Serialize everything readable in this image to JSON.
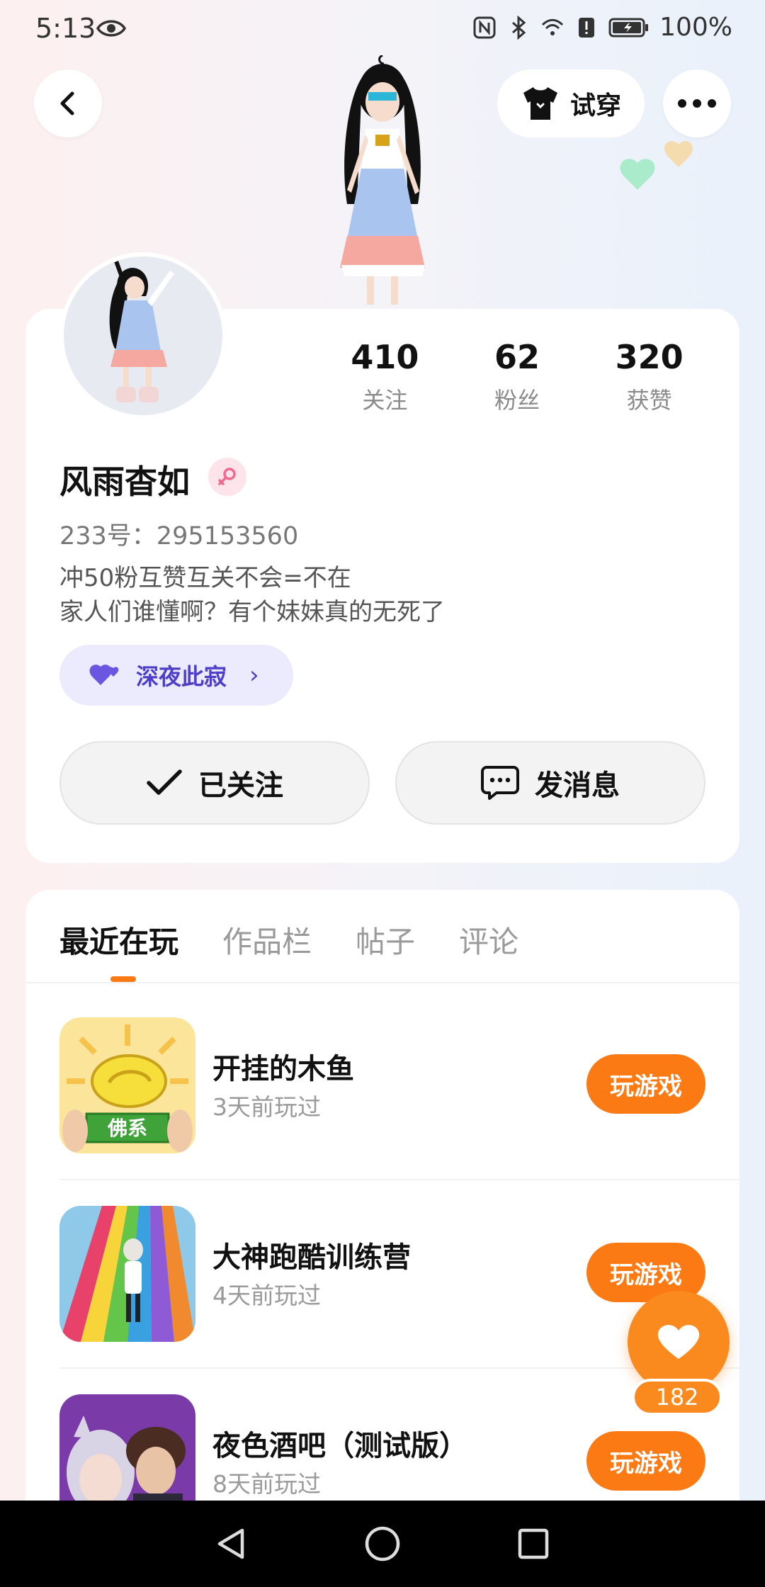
{
  "status_bar": {
    "time": "5:13",
    "battery": "100%"
  },
  "top_nav": {
    "try_on_label": "试穿"
  },
  "profile": {
    "stats": [
      {
        "value": "410",
        "label": "关注"
      },
      {
        "value": "62",
        "label": "粉丝"
      },
      {
        "value": "320",
        "label": "获赞"
      }
    ],
    "username": "风雨杳如",
    "account_id": "233号：295153560",
    "bio_line1": "冲50粉互赞互关不会=不在",
    "bio_line2": "家人们谁懂啊？有个妹妹真的无死了",
    "tag_label": "深夜此寂",
    "follow_label": "已关注",
    "message_label": "发消息"
  },
  "tabs": [
    {
      "label": "最近在玩",
      "active": true
    },
    {
      "label": "作品栏",
      "active": false
    },
    {
      "label": "帖子",
      "active": false
    },
    {
      "label": "评论",
      "active": false
    }
  ],
  "games": [
    {
      "title": "开挂的木鱼",
      "subtitle": "3天前玩过",
      "button": "玩游戏",
      "icon_text": "佛系"
    },
    {
      "title": "大神跑酷训练营",
      "subtitle": "4天前玩过",
      "button": "玩游戏"
    },
    {
      "title": "夜色酒吧（测试版）",
      "subtitle": "8天前玩过",
      "button": "玩游戏"
    }
  ],
  "like_fab": {
    "count": "182"
  },
  "colors": {
    "accent_orange": "#fb7a14",
    "tag_purple": "#4e3ec8",
    "tag_bg": "#ecebfd"
  }
}
